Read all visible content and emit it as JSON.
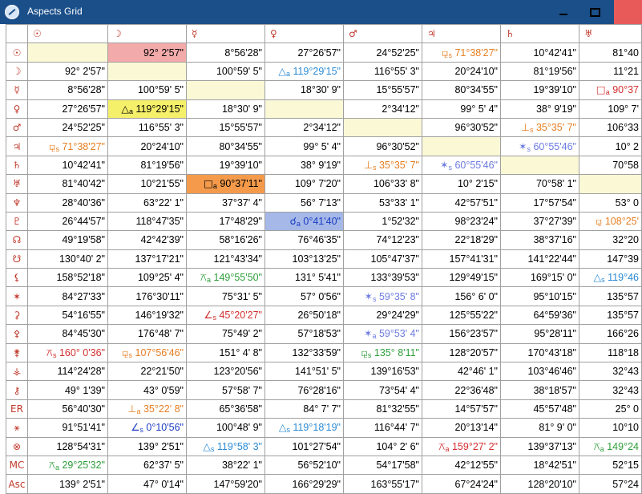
{
  "window": {
    "title": "Aspects Grid",
    "controls": [
      "minimize",
      "maximize",
      "close"
    ]
  },
  "colors": {
    "head_glyph": "#c0392b",
    "diag_blank": "#fbf8d6",
    "hl_pink": "#f3aaaa",
    "hl_yellow": "#f5f06a",
    "hl_orange": "#f49a4a",
    "hl_blue": "#a5b8e8"
  },
  "columns": [
    {
      "glyph": "☉",
      "name": "sun-icon"
    },
    {
      "glyph": "☽",
      "name": "moon-icon"
    },
    {
      "glyph": "☿",
      "name": "mercury-icon"
    },
    {
      "glyph": "♀",
      "name": "venus-icon"
    },
    {
      "glyph": "♂",
      "name": "mars-icon"
    },
    {
      "glyph": "♃",
      "name": "jupiter-icon"
    },
    {
      "glyph": "♄",
      "name": "saturn-icon"
    },
    {
      "glyph": "♅",
      "name": "uranus-icon"
    }
  ],
  "rows": [
    {
      "glyph": "☉",
      "name": "sun-icon",
      "cells": [
        {
          "blank": true
        },
        {
          "text": "92° 2'57\"",
          "hl": "pink"
        },
        {
          "text": "8°56'28\""
        },
        {
          "text": "27°26'57\""
        },
        {
          "text": "24°52'25\""
        },
        {
          "sym": "⚼",
          "sub": "s",
          "text": "71°38'27\"",
          "color": "#e67e22"
        },
        {
          "text": "10°42'41\""
        },
        {
          "text": "81°40"
        }
      ]
    },
    {
      "glyph": "☽",
      "name": "moon-icon",
      "cells": [
        {
          "text": "92° 2'57\""
        },
        {
          "blank": true
        },
        {
          "text": "100°59' 5\""
        },
        {
          "sym": "△",
          "sub": "a",
          "text": "119°29'15\"",
          "color": "#2a8ad4"
        },
        {
          "text": "116°55' 3\""
        },
        {
          "text": "20°24'10\""
        },
        {
          "text": "81°19'56\""
        },
        {
          "text": "11°21"
        }
      ]
    },
    {
      "glyph": "☿",
      "name": "mercury-icon",
      "cells": [
        {
          "text": "8°56'28\""
        },
        {
          "text": "100°59' 5\""
        },
        {
          "blank": true
        },
        {
          "text": "18°30' 9\""
        },
        {
          "text": "15°55'57\""
        },
        {
          "text": "80°34'55\""
        },
        {
          "text": "19°39'10\""
        },
        {
          "sym": "□",
          "sub": "a",
          "text": "90°37",
          "color": "#d32f2f"
        }
      ]
    },
    {
      "glyph": "♀",
      "name": "venus-icon",
      "cells": [
        {
          "text": "27°26'57\""
        },
        {
          "sym": "△",
          "sub": "a",
          "text": "119°29'15\"",
          "color": "#000000",
          "hl": "yellow"
        },
        {
          "text": "18°30' 9\""
        },
        {
          "blank": true
        },
        {
          "text": "2°34'12\""
        },
        {
          "text": "99° 5' 4\""
        },
        {
          "text": "38° 9'19\""
        },
        {
          "text": "109° 7'"
        }
      ]
    },
    {
      "glyph": "♂",
      "name": "mars-icon",
      "cells": [
        {
          "text": "24°52'25\""
        },
        {
          "text": "116°55' 3\""
        },
        {
          "text": "15°55'57\""
        },
        {
          "text": "2°34'12\""
        },
        {
          "blank": true
        },
        {
          "text": "96°30'52\""
        },
        {
          "sym": "⊥",
          "sub": "s",
          "text": "35°35' 7\"",
          "color": "#e67e22"
        },
        {
          "text": "106°33"
        }
      ]
    },
    {
      "glyph": "♃",
      "name": "jupiter-icon",
      "cells": [
        {
          "sym": "⚼",
          "sub": "s",
          "text": "71°38'27\"",
          "color": "#e67e22"
        },
        {
          "text": "20°24'10\""
        },
        {
          "text": "80°34'55\""
        },
        {
          "text": "99° 5' 4\""
        },
        {
          "text": "96°30'52\""
        },
        {
          "blank": true
        },
        {
          "sym": "✶",
          "sub": "s",
          "text": "60°55'46\"",
          "color": "#6c7be0"
        },
        {
          "text": "10° 2"
        }
      ]
    },
    {
      "glyph": "♄",
      "name": "saturn-icon",
      "cells": [
        {
          "text": "10°42'41\""
        },
        {
          "text": "81°19'56\""
        },
        {
          "text": "19°39'10\""
        },
        {
          "text": "38° 9'19\""
        },
        {
          "sym": "⊥",
          "sub": "s",
          "text": "35°35' 7\"",
          "color": "#e67e22"
        },
        {
          "sym": "✶",
          "sub": "s",
          "text": "60°55'46\"",
          "color": "#6c7be0"
        },
        {
          "blank": true
        },
        {
          "text": "70°58"
        }
      ]
    },
    {
      "glyph": "♅",
      "name": "uranus-icon",
      "cells": [
        {
          "text": "81°40'42\""
        },
        {
          "text": "10°21'55\""
        },
        {
          "sym": "□",
          "sub": "a",
          "text": "90°37'11\"",
          "color": "#000000",
          "hl": "orange"
        },
        {
          "sym": "",
          "sub": "",
          "text": "109° 7'20\""
        },
        {
          "text": "106°33' 8\""
        },
        {
          "text": "10° 2'15\""
        },
        {
          "text": "70°58' 1\""
        },
        {
          "blank": true
        }
      ]
    },
    {
      "glyph": "♆",
      "name": "neptune-icon",
      "cells": [
        {
          "text": "28°40'36\""
        },
        {
          "text": "63°22' 1\""
        },
        {
          "text": "37°37' 4\""
        },
        {
          "text": "56° 7'13\""
        },
        {
          "text": "53°33' 1\""
        },
        {
          "text": "42°57'51\""
        },
        {
          "text": "17°57'54\""
        },
        {
          "text": "53° 0"
        }
      ]
    },
    {
      "glyph": "♇",
      "name": "pluto-icon",
      "cells": [
        {
          "text": "26°44'57\""
        },
        {
          "text": "118°47'35\""
        },
        {
          "text": "17°48'29\""
        },
        {
          "sym": "☌",
          "sub": "a",
          "text": "0°41'40\"",
          "color": "#1a3cc0",
          "hl": "blue"
        },
        {
          "text": "1°52'32\""
        },
        {
          "text": "98°23'24\""
        },
        {
          "text": "37°27'39\""
        },
        {
          "sym": "⚼",
          "sub": "",
          "text": "108°25'",
          "color": "#e67e22"
        }
      ]
    },
    {
      "glyph": "☊",
      "name": "north-node-icon",
      "cells": [
        {
          "text": "49°19'58\""
        },
        {
          "text": "42°42'39\""
        },
        {
          "text": "58°16'26\""
        },
        {
          "text": "76°46'35\""
        },
        {
          "text": "74°12'23\""
        },
        {
          "text": "22°18'29\""
        },
        {
          "text": "38°37'16\""
        },
        {
          "text": "32°20"
        }
      ]
    },
    {
      "glyph": "☋",
      "name": "south-node-icon",
      "cells": [
        {
          "text": "130°40' 2\""
        },
        {
          "text": "137°17'21\""
        },
        {
          "text": "121°43'34\""
        },
        {
          "text": "103°13'25\""
        },
        {
          "text": "105°47'37\""
        },
        {
          "text": "157°41'31\""
        },
        {
          "text": "141°22'44\""
        },
        {
          "text": "147°39"
        }
      ]
    },
    {
      "glyph": "⚸",
      "name": "lilith-icon",
      "cells": [
        {
          "text": "158°52'18\""
        },
        {
          "text": "109°25' 4\""
        },
        {
          "sym": "⚻",
          "sub": "a",
          "text": "149°55'50\"",
          "color": "#2e9e3a"
        },
        {
          "text": "131° 5'41\""
        },
        {
          "text": "133°39'53\""
        },
        {
          "text": "129°49'15\""
        },
        {
          "text": "169°15' 0\""
        },
        {
          "sym": "△",
          "sub": "s",
          "text": "119°46",
          "color": "#2a8ad4"
        }
      ]
    },
    {
      "glyph": "✶",
      "name": "vertex-star-icon",
      "cells": [
        {
          "text": "84°27'33\""
        },
        {
          "text": "176°30'11\""
        },
        {
          "text": "75°31' 5\""
        },
        {
          "text": "57° 0'56\""
        },
        {
          "sym": "✶",
          "sub": "s",
          "text": "59°35' 8\"",
          "color": "#6c7be0"
        },
        {
          "text": "156° 6' 0\""
        },
        {
          "text": "95°10'15\""
        },
        {
          "text": "135°57"
        }
      ]
    },
    {
      "glyph": "⚳",
      "name": "ceres-icon",
      "cells": [
        {
          "text": "54°16'55\""
        },
        {
          "text": "146°19'32\""
        },
        {
          "sym": "∠",
          "sub": "s",
          "text": "45°20'27\"",
          "color": "#d32f2f"
        },
        {
          "text": "26°50'18\""
        },
        {
          "text": "29°24'29\""
        },
        {
          "text": "125°55'22\""
        },
        {
          "text": "64°59'36\""
        },
        {
          "text": "135°57"
        }
      ]
    },
    {
      "glyph": "⚴",
      "name": "pallas-icon",
      "cells": [
        {
          "text": "84°45'30\""
        },
        {
          "text": "176°48' 7\""
        },
        {
          "text": "75°49' 2\""
        },
        {
          "text": "57°18'53\""
        },
        {
          "sym": "✶",
          "sub": "a",
          "text": "59°53' 4\"",
          "color": "#6c7be0"
        },
        {
          "text": "156°23'57\""
        },
        {
          "text": "95°28'11\""
        },
        {
          "text": "166°26"
        }
      ]
    },
    {
      "glyph": "⚵",
      "name": "juno-icon",
      "cells": [
        {
          "sym": "⚻",
          "sub": "s",
          "text": "160° 0'36\"",
          "color": "#d32f2f"
        },
        {
          "sym": "⚼",
          "sub": "s",
          "text": "107°56'46\"",
          "color": "#e67e22"
        },
        {
          "text": "151° 4' 8\""
        },
        {
          "text": "132°33'59\""
        },
        {
          "sym": "⚼",
          "sub": "s",
          "text": "135° 8'11\"",
          "color": "#2e9e3a"
        },
        {
          "text": "128°20'57\""
        },
        {
          "text": "170°43'18\""
        },
        {
          "text": "118°18"
        }
      ]
    },
    {
      "glyph": "⚶",
      "name": "vesta-icon",
      "cells": [
        {
          "text": "114°24'28\""
        },
        {
          "text": "22°21'50\""
        },
        {
          "text": "123°20'56\""
        },
        {
          "text": "141°51' 5\""
        },
        {
          "text": "139°16'53\""
        },
        {
          "text": "42°46' 1\""
        },
        {
          "text": "103°46'46\""
        },
        {
          "text": "32°43"
        }
      ]
    },
    {
      "glyph": "⚷",
      "name": "chiron-icon",
      "cells": [
        {
          "text": "49° 1'39\""
        },
        {
          "text": "43° 0'59\""
        },
        {
          "text": "57°58' 7\""
        },
        {
          "text": "76°28'16\""
        },
        {
          "text": "73°54' 4\""
        },
        {
          "text": "22°36'48\""
        },
        {
          "text": "38°18'57\""
        },
        {
          "text": "32°43"
        }
      ]
    },
    {
      "glyph": "ER",
      "name": "eris-label",
      "cells": [
        {
          "text": "56°40'30\""
        },
        {
          "sym": "⊥",
          "sub": "a",
          "text": "35°22' 8\"",
          "color": "#e67e22"
        },
        {
          "text": "65°36'58\""
        },
        {
          "text": "84° 7' 7\""
        },
        {
          "text": "81°32'55\""
        },
        {
          "text": "14°57'57\""
        },
        {
          "text": "45°57'48\""
        },
        {
          "text": "25° 0"
        }
      ]
    },
    {
      "glyph": "⚹",
      "name": "fortune-part-icon",
      "cells": [
        {
          "text": "91°51'41\""
        },
        {
          "sym": "∠",
          "sub": "s",
          "text": "0°10'56\"",
          "color": "#1a3cc0"
        },
        {
          "text": "100°48' 9\""
        },
        {
          "sym": "△",
          "sub": "s",
          "text": "119°18'19\"",
          "color": "#2a8ad4"
        },
        {
          "text": "116°44' 7\""
        },
        {
          "text": "20°13'14\""
        },
        {
          "text": "81° 9' 0\""
        },
        {
          "text": "10°10"
        }
      ]
    },
    {
      "glyph": "⊗",
      "name": "fortune-icon",
      "cells": [
        {
          "text": "128°54'31\""
        },
        {
          "text": "139° 2'51\""
        },
        {
          "sym": "△",
          "sub": "s",
          "text": "119°58' 3\"",
          "color": "#2a8ad4"
        },
        {
          "text": "101°27'54\""
        },
        {
          "text": "104° 2' 6\""
        },
        {
          "sym": "⚻",
          "sub": "a",
          "text": "159°27' 2\"",
          "color": "#d32f2f"
        },
        {
          "text": "139°37'13\""
        },
        {
          "sym": "⚻",
          "sub": "a",
          "text": "149°24",
          "color": "#2e9e3a"
        }
      ]
    },
    {
      "glyph": "MC",
      "name": "midheaven-label",
      "cells": [
        {
          "sym": "⚻",
          "sub": "a",
          "text": "29°25'32\"",
          "color": "#2e9e3a"
        },
        {
          "text": "62°37' 5\""
        },
        {
          "text": "38°22' 1\""
        },
        {
          "text": "56°52'10\""
        },
        {
          "text": "54°17'58\""
        },
        {
          "text": "42°12'55\""
        },
        {
          "text": "18°42'51\""
        },
        {
          "text": "52°15"
        }
      ]
    },
    {
      "glyph": "Asc",
      "name": "ascendant-label",
      "cells": [
        {
          "text": "139° 2'51\""
        },
        {
          "text": "47° 0'14\""
        },
        {
          "text": "147°59'20\""
        },
        {
          "text": "166°29'29\""
        },
        {
          "text": "163°55'17\""
        },
        {
          "text": "67°24'24\""
        },
        {
          "text": "128°20'10\""
        },
        {
          "text": "57°24"
        }
      ]
    }
  ]
}
